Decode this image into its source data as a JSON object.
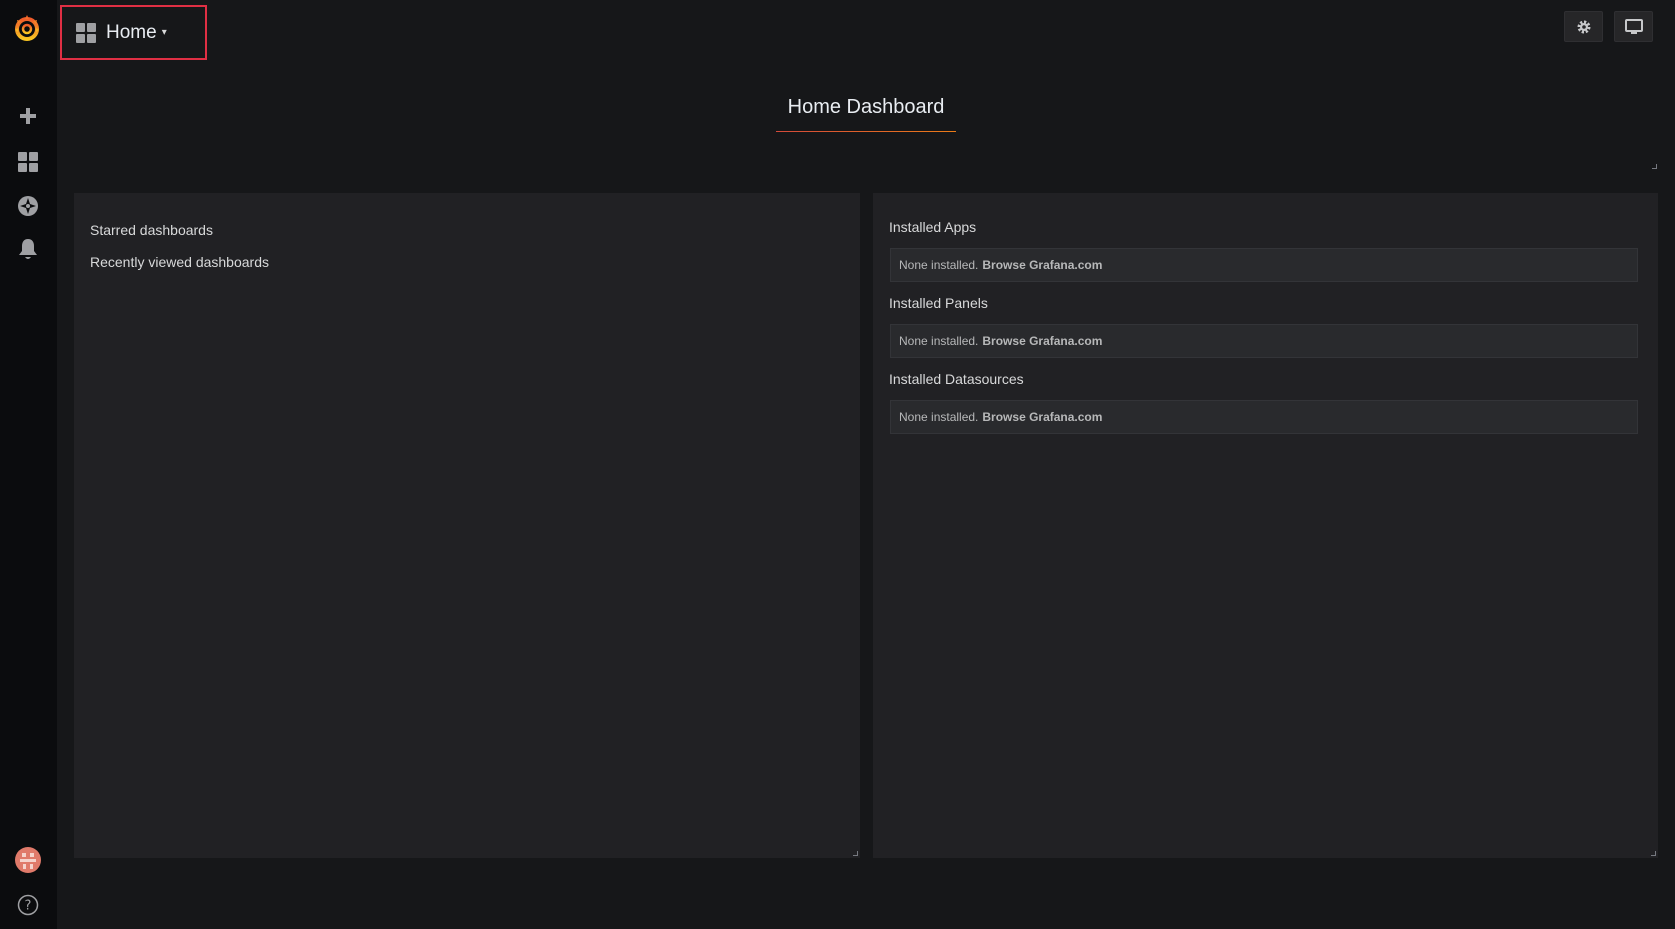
{
  "sidebar": {
    "icons": [
      "grafana-logo-icon",
      "plus-icon",
      "dashboards-icon",
      "explore-icon",
      "bell-icon",
      "avatar-icon",
      "help-icon"
    ]
  },
  "topnav": {
    "home_label": "Home",
    "caret": "▾"
  },
  "dashboard": {
    "title": "Home Dashboard"
  },
  "left_panel": {
    "starred": "Starred dashboards",
    "recent": "Recently viewed dashboards"
  },
  "right_panel": {
    "sections": [
      {
        "title": "Installed Apps",
        "none": "None installed.",
        "browse": "Browse Grafana.com"
      },
      {
        "title": "Installed Panels",
        "none": "None installed.",
        "browse": "Browse Grafana.com"
      },
      {
        "title": "Installed Datasources",
        "none": "None installed.",
        "browse": "Browse Grafana.com"
      }
    ]
  },
  "colors": {
    "accent_orange": "#eb7b18",
    "highlight_red": "#e02f44",
    "background": "#161719",
    "panel": "#212124"
  }
}
